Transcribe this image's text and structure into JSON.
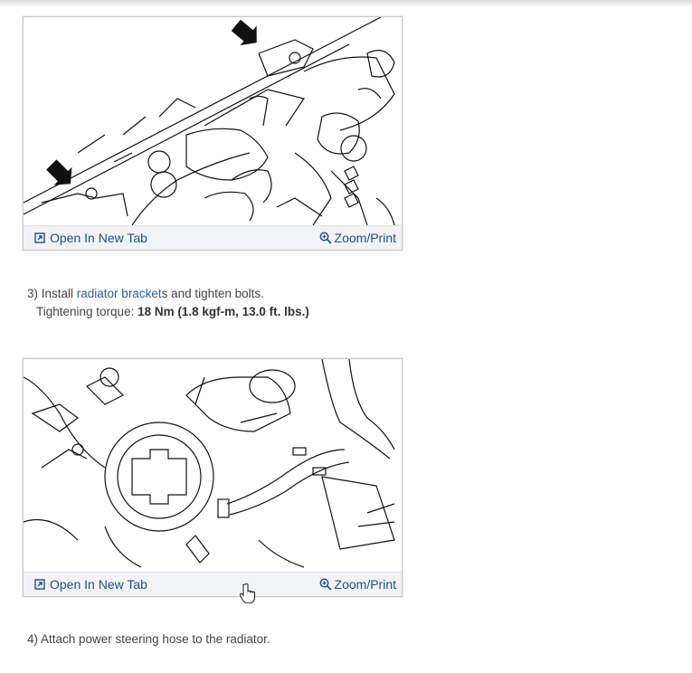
{
  "figures": [
    {
      "open_tab_label": "Open In New Tab",
      "zoom_label": "Zoom/Print"
    },
    {
      "open_tab_label": "Open In New Tab",
      "zoom_label": "Zoom/Print"
    }
  ],
  "step3": {
    "prefix": "3) Install ",
    "link_text": "radiator bracket",
    "suffix": "s and tighten bolts.",
    "torque_label": "Tightening torque: ",
    "torque_value": "18 Nm (1.8 kgf-m, 13.0 ft. lbs.)"
  },
  "step4": {
    "text": "4) Attach power steering hose to the radiator."
  },
  "icons": {
    "open_tab": "open-new-tab-icon",
    "zoom": "magnifier-icon",
    "cursor": "hand-pointer-icon"
  },
  "colors": {
    "link": "#2a5da8",
    "figure_bar": "#f1f3f7",
    "text": "#444444"
  }
}
